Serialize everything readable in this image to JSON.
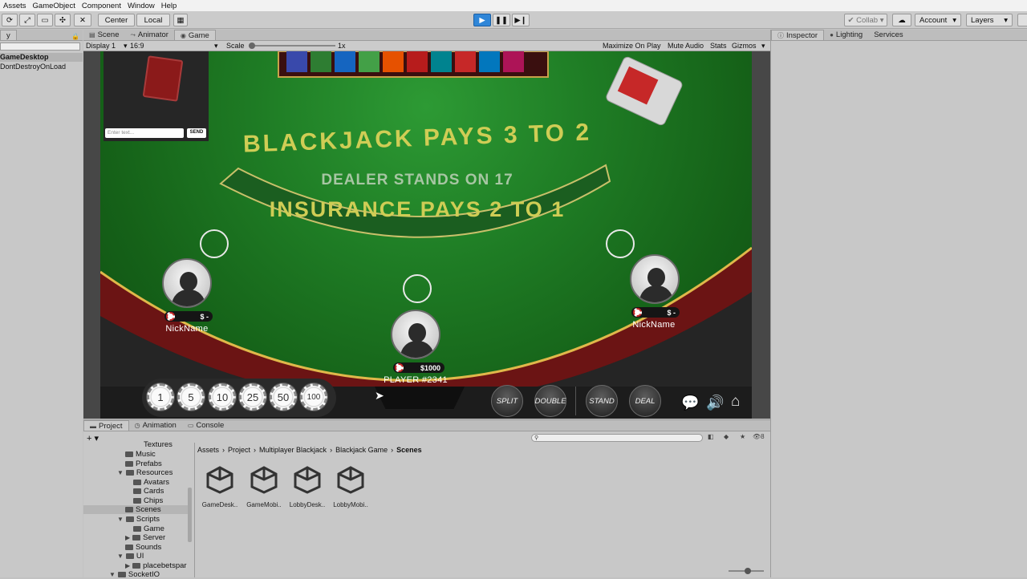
{
  "menu": [
    "Assets",
    "GameObject",
    "Component",
    "Window",
    "Help"
  ],
  "toolbar": {
    "pivot": "Center",
    "space": "Local",
    "collab": "Collab",
    "account": "Account",
    "layers": "Layers"
  },
  "hierarchy": {
    "tab": "y",
    "items": [
      "GameDesktop",
      "DontDestroyOnLoad"
    ]
  },
  "center_tabs": [
    "Scene",
    "Animator",
    "Game"
  ],
  "game_controls": {
    "display": "Display 1",
    "aspect": "16:9",
    "scale_label": "Scale",
    "scale_value": "1x",
    "maximize": "Maximize On Play",
    "mute": "Mute Audio",
    "stats": "Stats",
    "gizmos": "Gizmos"
  },
  "right_tabs": [
    "Inspector",
    "Lighting",
    "Services"
  ],
  "game": {
    "chat_placeholder": "Enter text...",
    "send": "SEND",
    "table_line1": "BLACKJACK  PAYS 3 TO 2",
    "table_line2": "DEALER STANDS ON 17",
    "table_line3": "INSURANCE PAYS 2 TO 1",
    "players": {
      "left": {
        "name": "NickName",
        "balance": "$ -"
      },
      "center": {
        "name": "PLAYER #2341",
        "balance": "$1000"
      },
      "right": {
        "name": "NickName",
        "balance": "$ -"
      }
    },
    "chips": [
      "1",
      "5",
      "10",
      "25",
      "50",
      "100"
    ],
    "actions": [
      "SPLIT",
      "DOUBLE",
      "STAND",
      "DEAL"
    ]
  },
  "bottom_tabs": [
    "Project",
    "Animation",
    "Console"
  ],
  "project": {
    "hidden_count": "8",
    "breadcrumb": [
      "Assets",
      "Project",
      "Multiplayer Blackjack",
      "Blackjack Game",
      "Scenes"
    ],
    "tree": [
      "Textures",
      "Music",
      "Prefabs",
      "Resources",
      "Avatars",
      "Cards",
      "Chips",
      "Scenes",
      "Scripts",
      "Game",
      "Server",
      "Sounds",
      "UI",
      "placebetspar",
      "SocketIO"
    ],
    "assets": [
      "GameDesk..",
      "GameMobi..",
      "LobbyDesk..",
      "LobbyMobi.."
    ]
  }
}
